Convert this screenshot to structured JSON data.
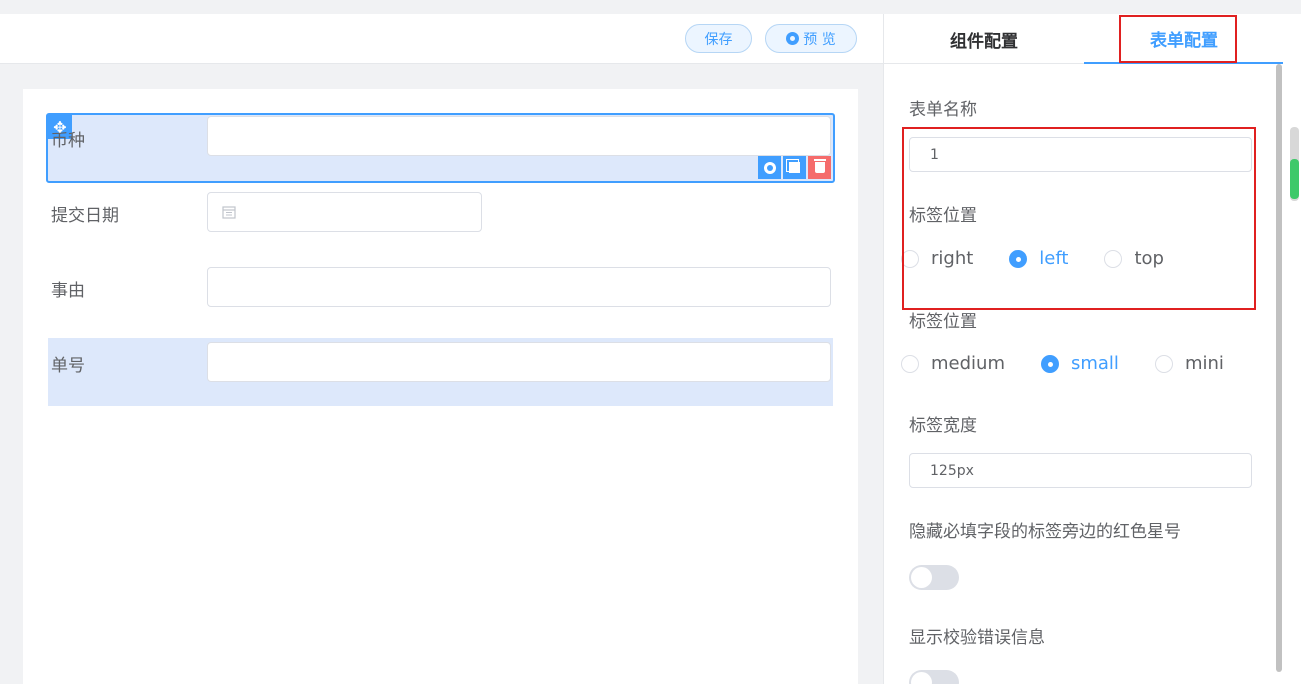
{
  "toolbar": {
    "save_label": "保存",
    "preview_label": "预 览"
  },
  "form_fields": [
    {
      "label": "币种"
    },
    {
      "label": "提交日期"
    },
    {
      "label": "事由"
    },
    {
      "label": "单号"
    }
  ],
  "tabs": [
    {
      "label": "组件配置",
      "active": false
    },
    {
      "label": "表单配置",
      "active": true
    }
  ],
  "config": {
    "form_name_label": "表单名称",
    "form_name_value": "1",
    "label_position_label": "标签位置",
    "label_position_options": [
      "right",
      "left",
      "top"
    ],
    "label_position_selected": "left",
    "size_label": "标签位置",
    "size_options": [
      "medium",
      "small",
      "mini"
    ],
    "size_selected": "small",
    "label_width_label": "标签宽度",
    "label_width_value": "125px",
    "hide_required_label": "隐藏必填字段的标签旁边的红色星号",
    "hide_required_on": false,
    "show_error_label": "显示校验错误信息",
    "show_error_on": false
  },
  "colors": {
    "accent": "#409eff",
    "highlight_box": "#e02020",
    "selected_bg": "#dde8fb"
  },
  "icons": [
    "eye-icon",
    "move-icon",
    "calendar-icon",
    "add-icon",
    "copy-icon",
    "delete-icon"
  ]
}
